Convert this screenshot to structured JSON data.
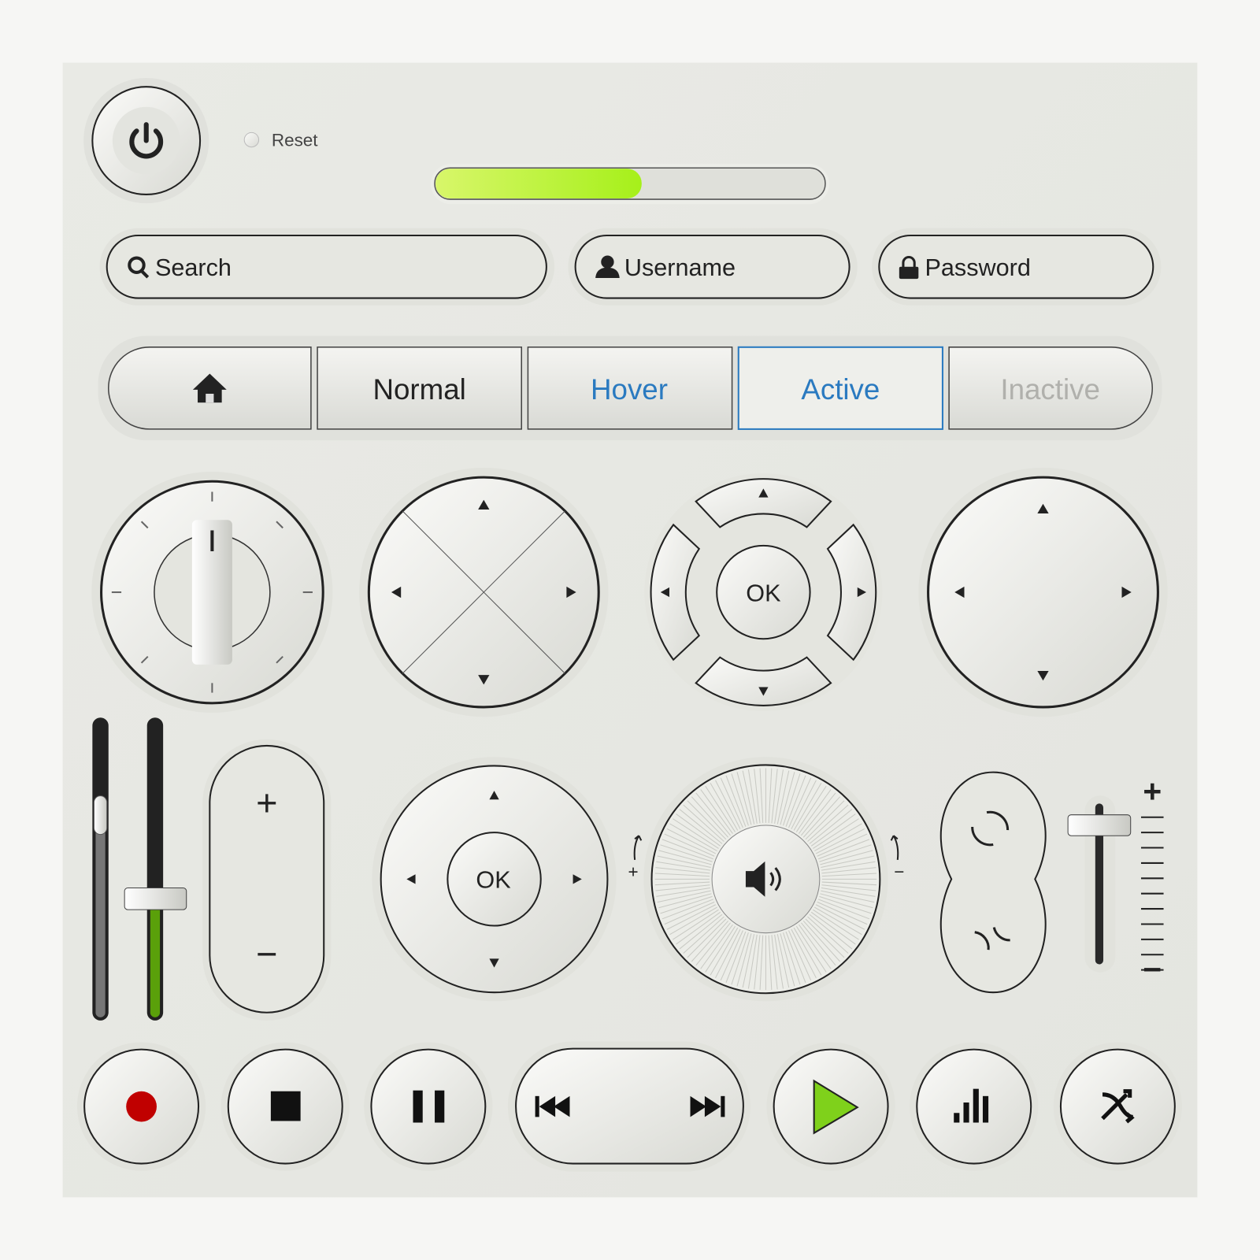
{
  "reset": {
    "label": "Reset"
  },
  "progress": {
    "value_percent": 53,
    "color": "#a6f01a"
  },
  "inputs": {
    "search_placeholder": "Search",
    "username_placeholder": "Username",
    "password_placeholder": "Password"
  },
  "tabs": [
    {
      "icon": "home-icon",
      "state": "home"
    },
    {
      "label": "Normal",
      "state": "normal"
    },
    {
      "label": "Hover",
      "state": "hover"
    },
    {
      "label": "Active",
      "state": "active"
    },
    {
      "label": "Inactive",
      "state": "inactive"
    }
  ],
  "colors": {
    "accent": "#2a7ac0",
    "inactive": "#b0b0ac",
    "record": "#c00000",
    "play": "#7fd11b",
    "slider_fill": "#5aa00a"
  },
  "dpad": {
    "ok_label": "OK"
  },
  "remote": {
    "ok_label": "OK"
  },
  "zoom_stepper": {
    "plus": "+",
    "minus": "−"
  },
  "volume_knob": {
    "plus": "+",
    "minus": "−"
  },
  "right_slider": {
    "plus": "+",
    "minus": "−",
    "value_fraction": 0.9
  },
  "left_sliders": {
    "dark_value_fraction": 0.68,
    "green_value_fraction": 0.4
  },
  "media": [
    "record",
    "stop",
    "pause",
    "previous",
    "next",
    "play",
    "equalizer",
    "shuffle"
  ]
}
